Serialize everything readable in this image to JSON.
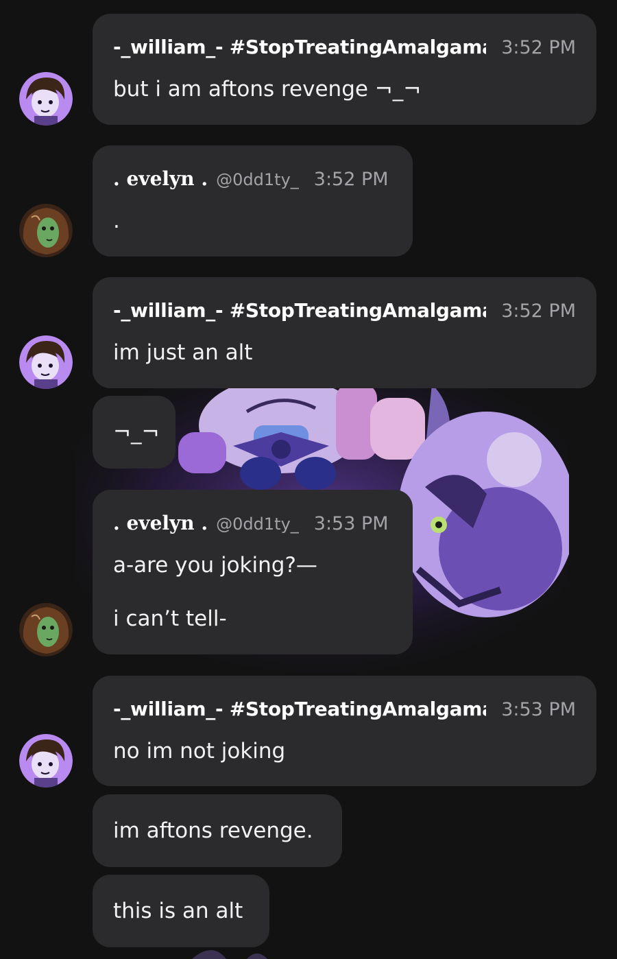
{
  "messages": [
    {
      "author": "-_william_- #StopTreatingAmalgama",
      "time": "3:52 PM",
      "lines": [
        "but i am aftons revenge ¬_¬"
      ],
      "followups": []
    },
    {
      "author": ". evelyn .",
      "handle": "@0dd1ty_",
      "time": "3:52 PM",
      "lines": [
        "."
      ],
      "followups": []
    },
    {
      "author": "-_william_- #StopTreatingAmalgama",
      "time": "3:52 PM",
      "lines": [
        "im just an alt"
      ],
      "followups": [
        "¬_¬"
      ]
    },
    {
      "author": ". evelyn .",
      "handle": "@0dd1ty_",
      "time": "3:53 PM",
      "lines": [
        "a-are you joking?—",
        "i can’t tell-"
      ],
      "followups": []
    },
    {
      "author": "-_william_- #StopTreatingAmalgama",
      "time": "3:53 PM",
      "lines": [
        "no im not joking"
      ],
      "followups": [
        "im aftons revenge.",
        "this is an alt"
      ]
    }
  ],
  "colors": {
    "background": "#121212",
    "bubble": "#2b2b2d",
    "timestamp": "#a4a4a8",
    "text": "#f2f2f2"
  }
}
